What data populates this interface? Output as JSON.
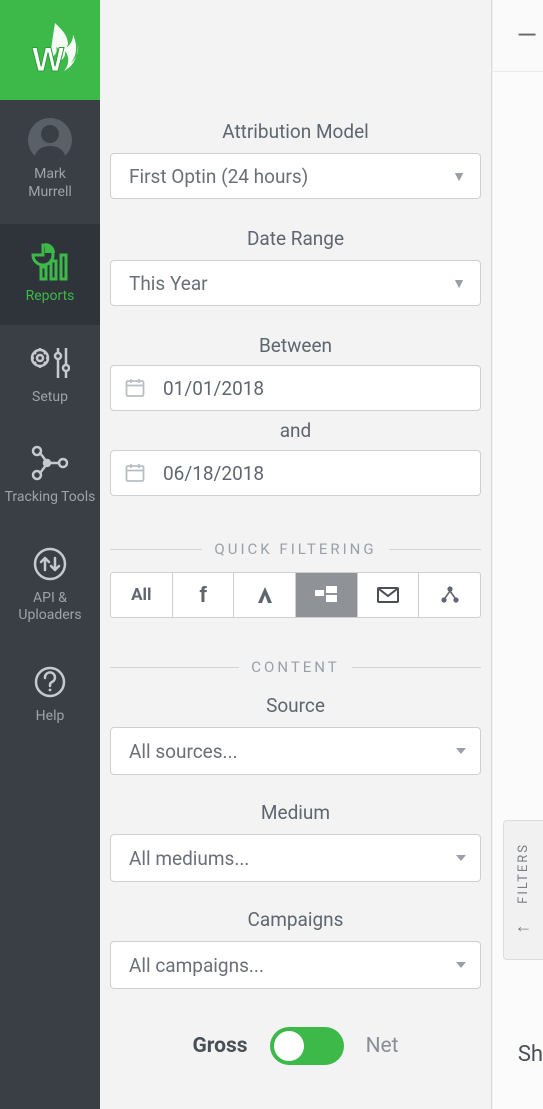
{
  "rail": {
    "profile_name_line1": "Mark",
    "profile_name_line2": "Murrell",
    "items": [
      {
        "label": "Reports"
      },
      {
        "label": "Setup"
      },
      {
        "label": "Tracking Tools"
      },
      {
        "label": "API & Uploaders"
      },
      {
        "label": "Help"
      }
    ]
  },
  "filters": {
    "attribution_label": "Attribution Model",
    "attribution_value": "First Optin (24 hours)",
    "date_range_label": "Date Range",
    "date_range_value": "This Year",
    "between_label": "Between",
    "date_from": "01/01/2018",
    "and_label": "and",
    "date_to": "06/18/2018",
    "quick_filtering_heading": "QUICK FILTERING",
    "qf_all": "All",
    "content_heading": "CONTENT",
    "source_label": "Source",
    "source_value": "All sources...",
    "medium_label": "Medium",
    "medium_value": "All mediums...",
    "campaigns_label": "Campaigns",
    "campaigns_value": "All campaigns...",
    "gross_label": "Gross",
    "net_label": "Net"
  },
  "right": {
    "dash": "—",
    "filters_tab": "FILTERS",
    "sh": "Sh"
  }
}
